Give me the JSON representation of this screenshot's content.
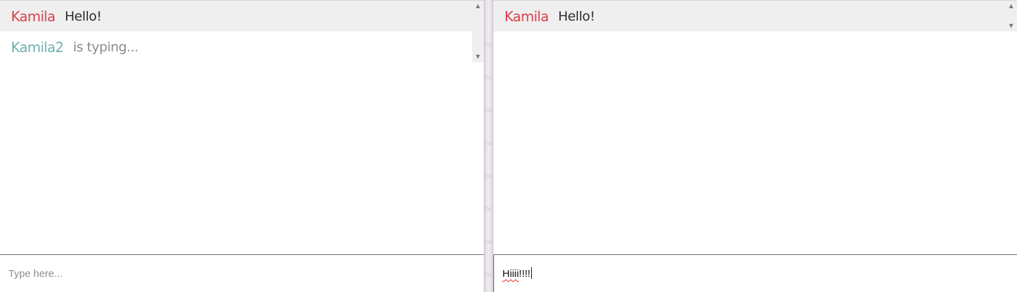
{
  "left_pane": {
    "messages": [
      {
        "user": "Kamila",
        "text": "Hello!"
      },
      {
        "user": "Kamila2",
        "text": "is typing..."
      }
    ],
    "input": {
      "placeholder": "Type here...",
      "value": ""
    }
  },
  "right_pane": {
    "messages": [
      {
        "user": "Kamila",
        "text": "Hello!"
      }
    ],
    "input": {
      "placeholder": "",
      "value_misspelled": "Hiiii",
      "value_rest": "!!!!"
    }
  },
  "colors": {
    "user_primary": "#d9414a",
    "user_secondary": "#6fb1ad",
    "message_bg": "#efefef"
  },
  "icons": [
    "scroll-up-arrow-icon",
    "scroll-down-arrow-icon"
  ]
}
